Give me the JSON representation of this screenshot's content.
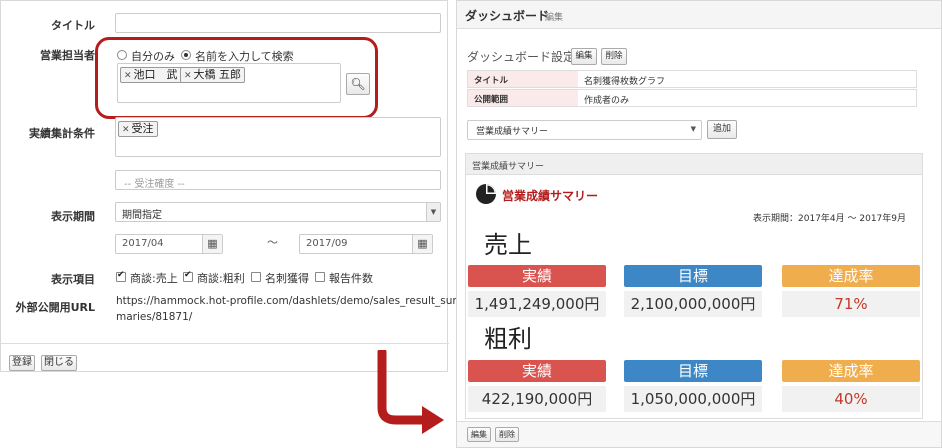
{
  "form": {
    "title_label": "タイトル",
    "owner_label": "営業担当者",
    "radio_self": "自分のみ",
    "radio_search": "名前を入力して検索",
    "owners": [
      "池口　武",
      "大橋 五郎"
    ],
    "conditions_label": "実績集計条件",
    "condition_tag": "受注",
    "certainty_placeholder": "-- 受注確度 --",
    "period_label": "表示期間",
    "period_value": "期間指定",
    "date_from": "2017/04",
    "date_sep": "～",
    "date_to": "2017/09",
    "items_label": "表示項目",
    "items": [
      {
        "label": "商談:売上",
        "checked": true
      },
      {
        "label": "商談:粗利",
        "checked": true
      },
      {
        "label": "名刺獲得",
        "checked": false
      },
      {
        "label": "報告件数",
        "checked": false
      }
    ],
    "url_label": "外部公開用URL",
    "url_line1": "https://hammock.hot-profile.com/dashlets/demo/sales_result_sum",
    "url_line2": "maries/81871/",
    "register_button": "登録",
    "close_button": "閉じる"
  },
  "dashboard": {
    "title": "ダッシュボード",
    "edit_link": "編集",
    "settings_title": "ダッシュボード設定",
    "edit_button": "編集",
    "delete_button": "削除",
    "table": [
      {
        "key": "タイトル",
        "value": "名刺獲得枚数グラフ"
      },
      {
        "key": "公開範囲",
        "value": "作成者のみ"
      }
    ],
    "select_value": "営業成績サマリー",
    "add_button": "追加",
    "widget_header": "営業成績サマリー",
    "widget_title": "営業成績サマリー",
    "period_text": "表示期間：2017年4月 ～ 2017年9月",
    "sections": [
      {
        "title": "売上",
        "actual_label": "実績",
        "actual_value": "1,491,249,000円",
        "target_label": "目標",
        "target_value": "2,100,000,000円",
        "rate_label": "達成率",
        "rate_value": "71%"
      },
      {
        "title": "粗利",
        "actual_label": "実績",
        "actual_value": "422,190,000円",
        "target_label": "目標",
        "target_value": "1,050,000,000円",
        "rate_label": "達成率",
        "rate_value": "40%"
      }
    ],
    "footer_edit": "編集",
    "footer_delete": "削除"
  },
  "colors": {
    "highlight": "#b51d1d",
    "actual": "#d9534f",
    "target": "#3d87c7",
    "rate": "#f0ad4e"
  }
}
